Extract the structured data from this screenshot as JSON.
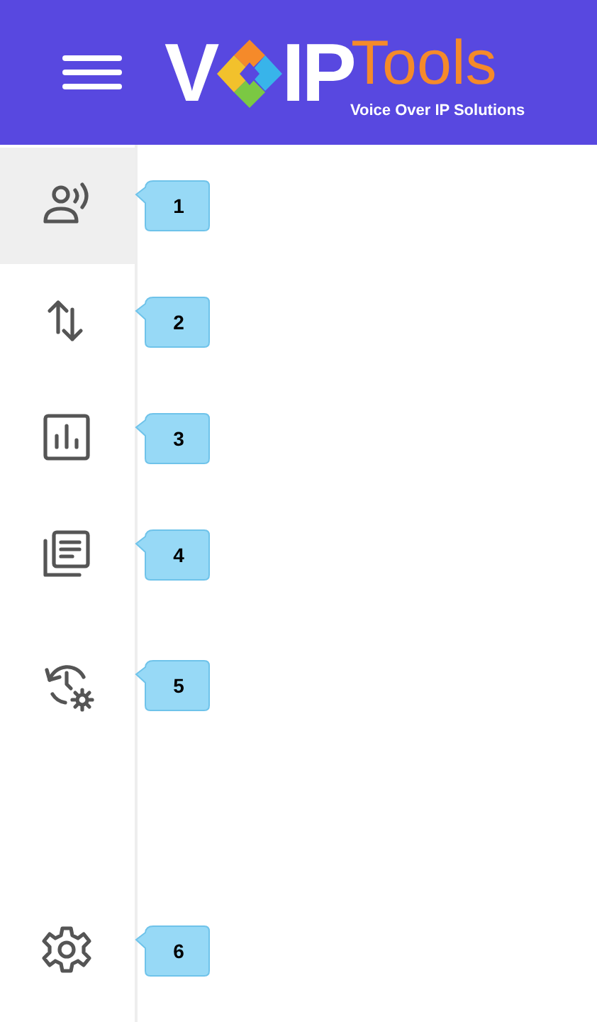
{
  "header": {
    "logo": {
      "lead": "V",
      "main": "IP",
      "accent": "Tools",
      "tagline": "Voice Over IP Solutions"
    }
  },
  "sidebar": {
    "items": [
      {
        "kind": "voice",
        "selected": true,
        "callout": "1"
      },
      {
        "kind": "transfer",
        "selected": false,
        "callout": "2"
      },
      {
        "kind": "chart",
        "selected": false,
        "callout": "3"
      },
      {
        "kind": "documents",
        "selected": false,
        "callout": "4"
      },
      {
        "kind": "history",
        "selected": false,
        "callout": "5"
      },
      {
        "kind": "settings",
        "selected": false,
        "callout": "6"
      }
    ]
  }
}
